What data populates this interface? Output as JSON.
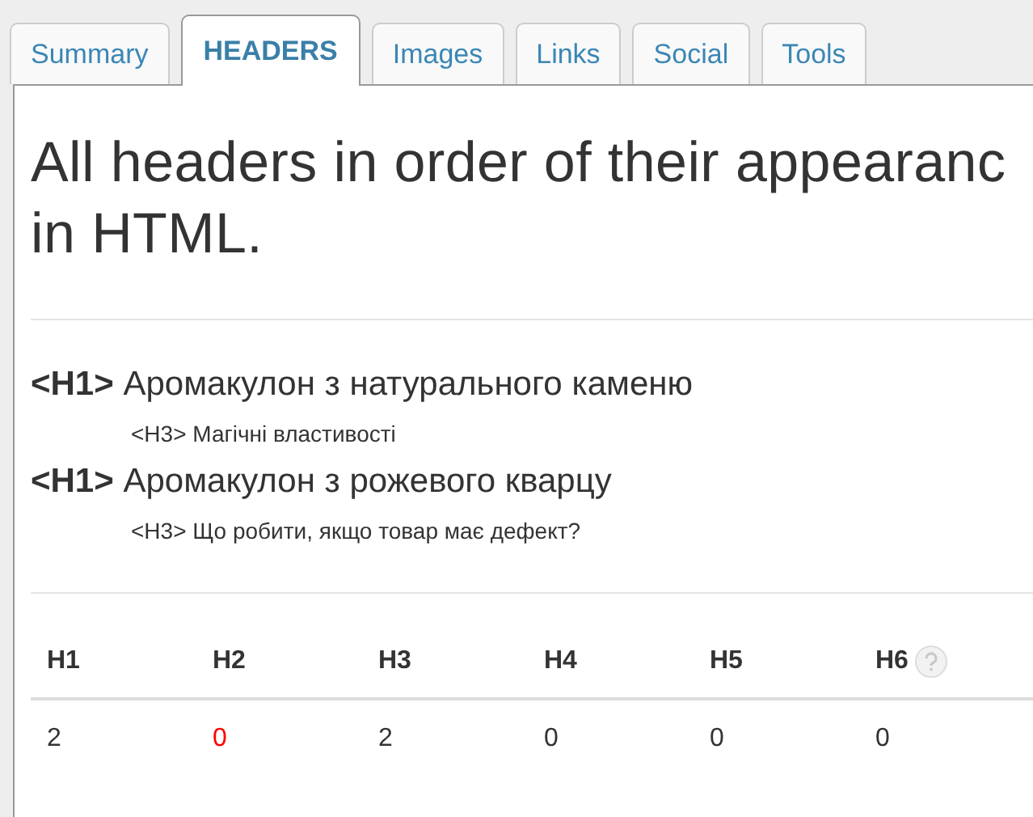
{
  "tabs": [
    {
      "label": "Summary",
      "selected": false
    },
    {
      "label": "HEADERS",
      "selected": true
    },
    {
      "label": "Images",
      "selected": false
    },
    {
      "label": "Links",
      "selected": false
    },
    {
      "label": "Social",
      "selected": false
    },
    {
      "label": "Tools",
      "selected": false
    }
  ],
  "title_lines": [
    "All headers in order of their appearanc",
    "in HTML."
  ],
  "headers": [
    {
      "tag": "<H1>",
      "text": "Аромакулон з натурального каменю",
      "children": [
        {
          "tag": "<H3>",
          "text": "Магічні властивості"
        }
      ]
    },
    {
      "tag": "<H1>",
      "text": "Аромакулон з рожевого кварцу",
      "children": [
        {
          "tag": "<H3>",
          "text": "Що робити, якщо товар має дефект?"
        }
      ]
    }
  ],
  "counts": [
    {
      "label": "H1",
      "value": "2",
      "warning": false
    },
    {
      "label": "H2",
      "value": "0",
      "warning": true
    },
    {
      "label": "H3",
      "value": "2",
      "warning": false
    },
    {
      "label": "H4",
      "value": "0",
      "warning": false
    },
    {
      "label": "H5",
      "value": "0",
      "warning": false
    },
    {
      "label": "H6",
      "value": "0",
      "warning": false,
      "help": true
    }
  ]
}
